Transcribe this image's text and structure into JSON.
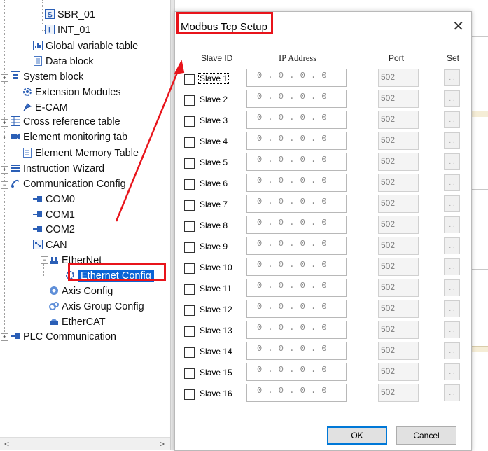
{
  "tree": {
    "items": [
      {
        "label": "SBR_01",
        "icon": "subroutine-icon"
      },
      {
        "label": "INT_01",
        "icon": "interrupt-icon"
      },
      {
        "label": "Global variable table",
        "icon": "table-icon"
      },
      {
        "label": "Data block",
        "icon": "document-icon"
      },
      {
        "label": "System block",
        "icon": "system-block-icon"
      },
      {
        "label": "Extension Modules",
        "icon": "gear-icon"
      },
      {
        "label": "E-CAM",
        "icon": "cam-icon"
      },
      {
        "label": "Cross reference table",
        "icon": "grid-icon"
      },
      {
        "label": "Element monitoring tab",
        "icon": "monitor-icon"
      },
      {
        "label": "Element Memory Table",
        "icon": "document-icon"
      },
      {
        "label": "Instruction Wizard",
        "icon": "list-icon"
      },
      {
        "label": "Communication Config",
        "icon": "communication-icon"
      },
      {
        "label": "COM0",
        "icon": "serial-port-icon"
      },
      {
        "label": "COM1",
        "icon": "serial-port-icon"
      },
      {
        "label": "COM2",
        "icon": "serial-port-icon"
      },
      {
        "label": "CAN",
        "icon": "can-icon"
      },
      {
        "label": "EtherNet",
        "icon": "network-icon"
      },
      {
        "label": "Ethernet Config",
        "icon": "ethernet-config-icon"
      },
      {
        "label": "Axis Config",
        "icon": "axis-icon"
      },
      {
        "label": "Axis Group Config",
        "icon": "axis-group-icon"
      },
      {
        "label": "EtherCAT",
        "icon": "ethercat-icon"
      },
      {
        "label": "PLC Communication",
        "icon": "serial-port-icon"
      }
    ]
  },
  "scroll": {
    "left_arrow": "<",
    "right_arrow": ">"
  },
  "dialog": {
    "title": "Modbus Tcp Setup",
    "close_glyph": "✕",
    "headers": {
      "slave_id": "Slave ID",
      "ip": "IP Address",
      "port": "Port",
      "set": "Set"
    },
    "slaves": [
      {
        "label": "Slave 1",
        "ip": "0 . 0 . 0 . 0",
        "port": "502",
        "set": "..."
      },
      {
        "label": "Slave 2",
        "ip": "0 . 0 . 0 . 0",
        "port": "502",
        "set": "..."
      },
      {
        "label": "Slave 3",
        "ip": "0 . 0 . 0 . 0",
        "port": "502",
        "set": "..."
      },
      {
        "label": "Slave 4",
        "ip": "0 . 0 . 0 . 0",
        "port": "502",
        "set": "..."
      },
      {
        "label": "Slave 5",
        "ip": "0 . 0 . 0 . 0",
        "port": "502",
        "set": "..."
      },
      {
        "label": "Slave 6",
        "ip": "0 . 0 . 0 . 0",
        "port": "502",
        "set": "..."
      },
      {
        "label": "Slave 7",
        "ip": "0 . 0 . 0 . 0",
        "port": "502",
        "set": "..."
      },
      {
        "label": "Slave 8",
        "ip": "0 . 0 . 0 . 0",
        "port": "502",
        "set": "..."
      },
      {
        "label": "Slave 9",
        "ip": "0 . 0 . 0 . 0",
        "port": "502",
        "set": "..."
      },
      {
        "label": "Slave 10",
        "ip": "0 . 0 . 0 . 0",
        "port": "502",
        "set": "..."
      },
      {
        "label": "Slave 11",
        "ip": "0 . 0 . 0 . 0",
        "port": "502",
        "set": "..."
      },
      {
        "label": "Slave 12",
        "ip": "0 . 0 . 0 . 0",
        "port": "502",
        "set": "..."
      },
      {
        "label": "Slave 13",
        "ip": "0 . 0 . 0 . 0",
        "port": "502",
        "set": "..."
      },
      {
        "label": "Slave 14",
        "ip": "0 . 0 . 0 . 0",
        "port": "502",
        "set": "..."
      },
      {
        "label": "Slave 15",
        "ip": "0 . 0 . 0 . 0",
        "port": "502",
        "set": "..."
      },
      {
        "label": "Slave 16",
        "ip": "0 . 0 . 0 . 0",
        "port": "502",
        "set": "..."
      }
    ],
    "ok_label": "OK",
    "cancel_label": "Cancel"
  },
  "colors": {
    "selection": "#0a64d6",
    "annotation_red": "#e8141b",
    "ok_border": "#0078d7"
  }
}
